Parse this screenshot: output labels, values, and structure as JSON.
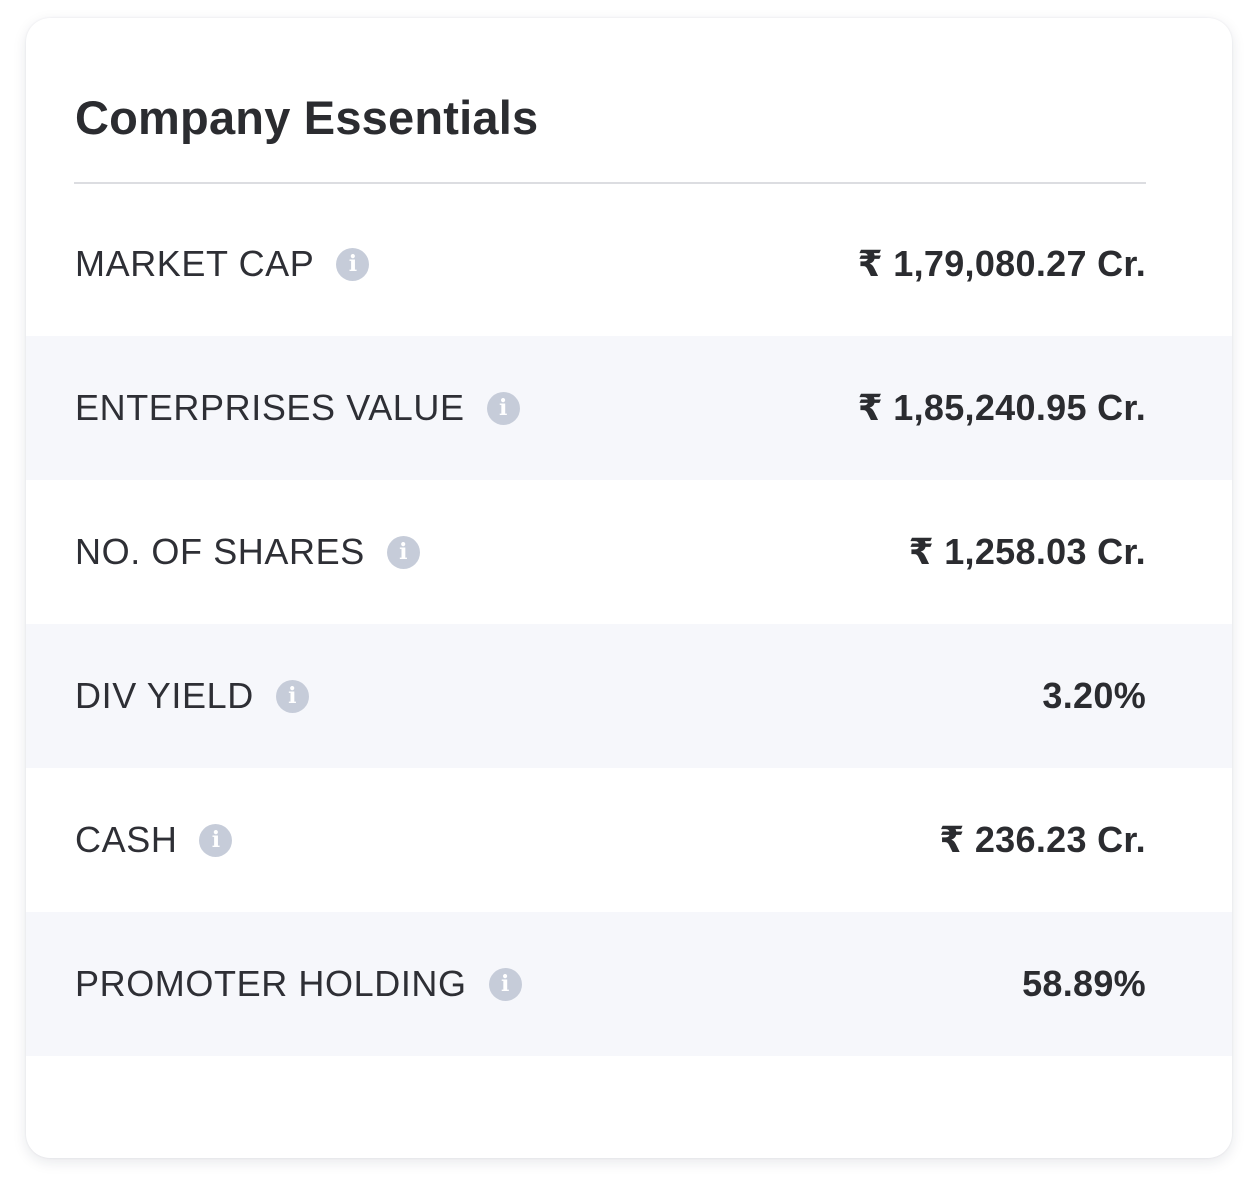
{
  "card": {
    "title": "Company Essentials"
  },
  "rows": [
    {
      "label": "MARKET CAP",
      "value": "₹ 1,79,080.27 Cr.",
      "icon": "info-icon"
    },
    {
      "label": "ENTERPRISES VALUE",
      "value": "₹ 1,85,240.95 Cr.",
      "icon": "info-icon"
    },
    {
      "label": "NO. OF SHARES",
      "value": "₹ 1,258.03 Cr.",
      "icon": "info-icon"
    },
    {
      "label": "DIV YIELD",
      "value": "3.20%",
      "icon": "info-icon"
    },
    {
      "label": "CASH",
      "value": "₹ 236.23 Cr.",
      "icon": "info-icon"
    },
    {
      "label": "PROMOTER HOLDING",
      "value": "58.89%",
      "icon": "info-icon"
    }
  ],
  "colors": {
    "text": "#2b2c30",
    "stripe": "#f6f7fb",
    "icon": "#c6ccd9",
    "divider": "#dcdde1"
  }
}
